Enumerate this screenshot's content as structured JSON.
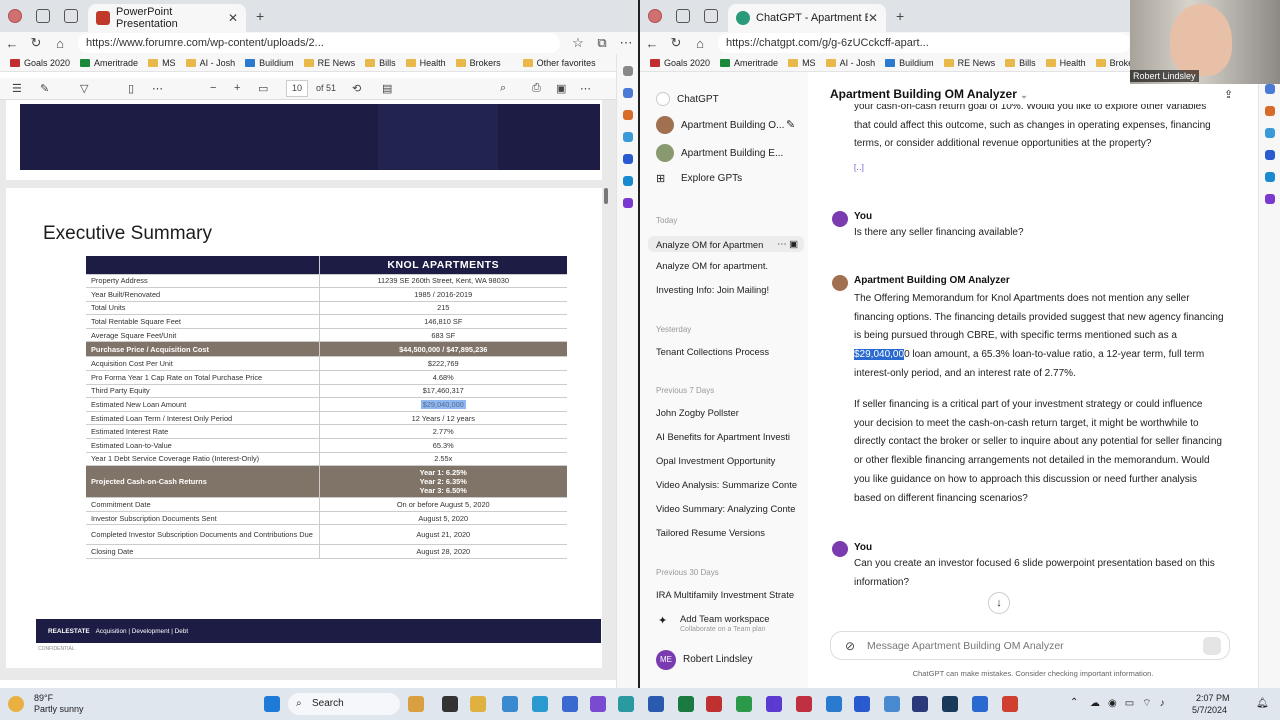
{
  "left_browser": {
    "tab_title": "PowerPoint Presentation",
    "url": "https://www.forumre.com/wp-content/uploads/2...",
    "favorites": [
      "Goals 2020",
      "Ameritrade",
      "MS",
      "AI - Josh",
      "Buildium",
      "RE News",
      "Bills",
      "Health",
      "Brokers"
    ],
    "other_favorites": "Other favorites",
    "pdf_toolbar": {
      "page_value": "10",
      "page_total": "of 51"
    }
  },
  "pdf": {
    "heading": "Executive Summary",
    "table_title": "KNOL APARTMENTS",
    "rows": [
      {
        "label": "Property Address",
        "value": "11239 SE 260th Street, Kent, WA 98030"
      },
      {
        "label": "Year Built/Renovated",
        "value": "1985 / 2016-2019"
      },
      {
        "label": "Total Units",
        "value": "215"
      },
      {
        "label": "Total Rentable Square Feet",
        "value": "146,810 SF"
      },
      {
        "label": "Average Square Feet/Unit",
        "value": "683 SF"
      }
    ],
    "purchase_row": {
      "label": "Purchase Price / Acquisition Cost",
      "value": "$44,500,000 / $47,895,236"
    },
    "rows2": [
      {
        "label": "Acquisition Cost Per Unit",
        "value": "$222,769"
      },
      {
        "label": "Pro Forma Year 1 Cap Rate on Total Purchase Price",
        "value": "4.68%"
      },
      {
        "label": "Third Party Equity",
        "value": "$17,460,317"
      },
      {
        "label": "Estimated New Loan Amount",
        "value": "$29,040,000"
      },
      {
        "label": "Estimated Loan Term / Interest Only Period",
        "value": "12 Years / 12 years"
      },
      {
        "label": "Estimated Interest Rate",
        "value": "2.77%"
      },
      {
        "label": "Estimated Loan-to-Value",
        "value": "65.3%"
      },
      {
        "label": "Year 1 Debt Service Coverage Ratio (Interest-Only)",
        "value": "2.55x"
      }
    ],
    "returns_row": {
      "label": "Projected Cash-on-Cash Returns",
      "y1": "Year 1: 6.25%",
      "y2": "Year 2: 6.35%",
      "y3": "Year 3: 6.50%"
    },
    "rows3": [
      {
        "label": "Commitment Date",
        "value": "On or before August 5, 2020"
      },
      {
        "label": "Investor Subscription Documents Sent",
        "value": "August 5, 2020"
      },
      {
        "label": "Completed Investor Subscription Documents and Contributions Due",
        "value": "August 21, 2020"
      },
      {
        "label": "Closing Date",
        "value": "August 28, 2020"
      }
    ],
    "footer": {
      "brand": "REALESTATE",
      "items": "Acquisition  |  Development  |  Debt",
      "confidential": "CONFIDENTIAL"
    }
  },
  "right_browser": {
    "tab_title": "ChatGPT - Apartment Building O",
    "url": "https://chatgpt.com/g/g-6zUCckcff-apart...",
    "favorites": [
      "Goals 2020",
      "Ameritrade",
      "MS",
      "AI - Josh",
      "Buildium",
      "RE News",
      "Bills",
      "Health",
      "Brokers"
    ]
  },
  "gpt_sidebar": {
    "chatgpt": "ChatGPT",
    "gpts": [
      "Apartment Building O...",
      "Apartment Building E..."
    ],
    "explore": "Explore GPTs",
    "today_label": "Today",
    "today": [
      "Analyze OM for Apartmen",
      "Analyze OM for apartment.",
      "Investing Info: Join Mailing!"
    ],
    "yesterday_label": "Yesterday",
    "yesterday": [
      "Tenant Collections Process"
    ],
    "prev7_label": "Previous 7 Days",
    "prev7": [
      "John Zogby Pollster",
      "AI Benefits for Apartment Investi",
      "Opal Investment Opportunity",
      "Video Analysis: Summarize Conte",
      "Video Summary: Analyzing Conte",
      "Tailored Resume Versions"
    ],
    "prev30_label": "Previous 30 Days",
    "prev30": [
      "IRA Multifamily Investment Strate"
    ],
    "add_team": "Add Team workspace",
    "add_team_sub": "Collaborate on a Team plan",
    "user": "Robert Lindsley",
    "user_initials": "ME"
  },
  "gpt_main": {
    "title": "Apartment Building OM Analyzer",
    "prev_text": "your cash-on-cash return goal of 10%. Would you like to explore other variables that could affect this outcome, such as changes in operating expenses, financing terms, or consider additional revenue opportunities at the property?",
    "you_label": "You",
    "q1": "Is there any seller financing available?",
    "bot_name": "Apartment Building OM Analyzer",
    "a1_pre": "The Offering Memorandum for Knol Apartments does not mention any seller financing options. The financing details provided suggest that new agency financing is being pursued through CBRE, with specific terms mentioned such as a ",
    "a1_hl": "$29,040,00",
    "a1_post": "0 loan amount, a 65.3% loan-to-value ratio, a 12-year term, full term interest-only period, and an interest rate of 2.77%.",
    "a2": "If seller financing is a critical part of your investment strategy or could influence your decision to meet the cash-on-cash return target, it might be worthwhile to directly contact the broker or seller to inquire about any potential for seller financing or other flexible financing arrangements not detailed in the memorandum. Would you like guidance on how to approach this discussion or need further analysis based on different financing scenarios?",
    "q2": "Can you create an investor focused 6 slide powerpoint presentation based on this information?",
    "composer_placeholder": "Message Apartment Building OM Analyzer",
    "disclaimer": "ChatGPT can make mistakes. Consider checking important information."
  },
  "video": {
    "name": "Robert Lindsley"
  },
  "taskbar": {
    "weather_temp": "89°F",
    "weather_desc": "Partly sunny",
    "search": "Search",
    "time": "2:07 PM",
    "date": "5/7/2024"
  }
}
